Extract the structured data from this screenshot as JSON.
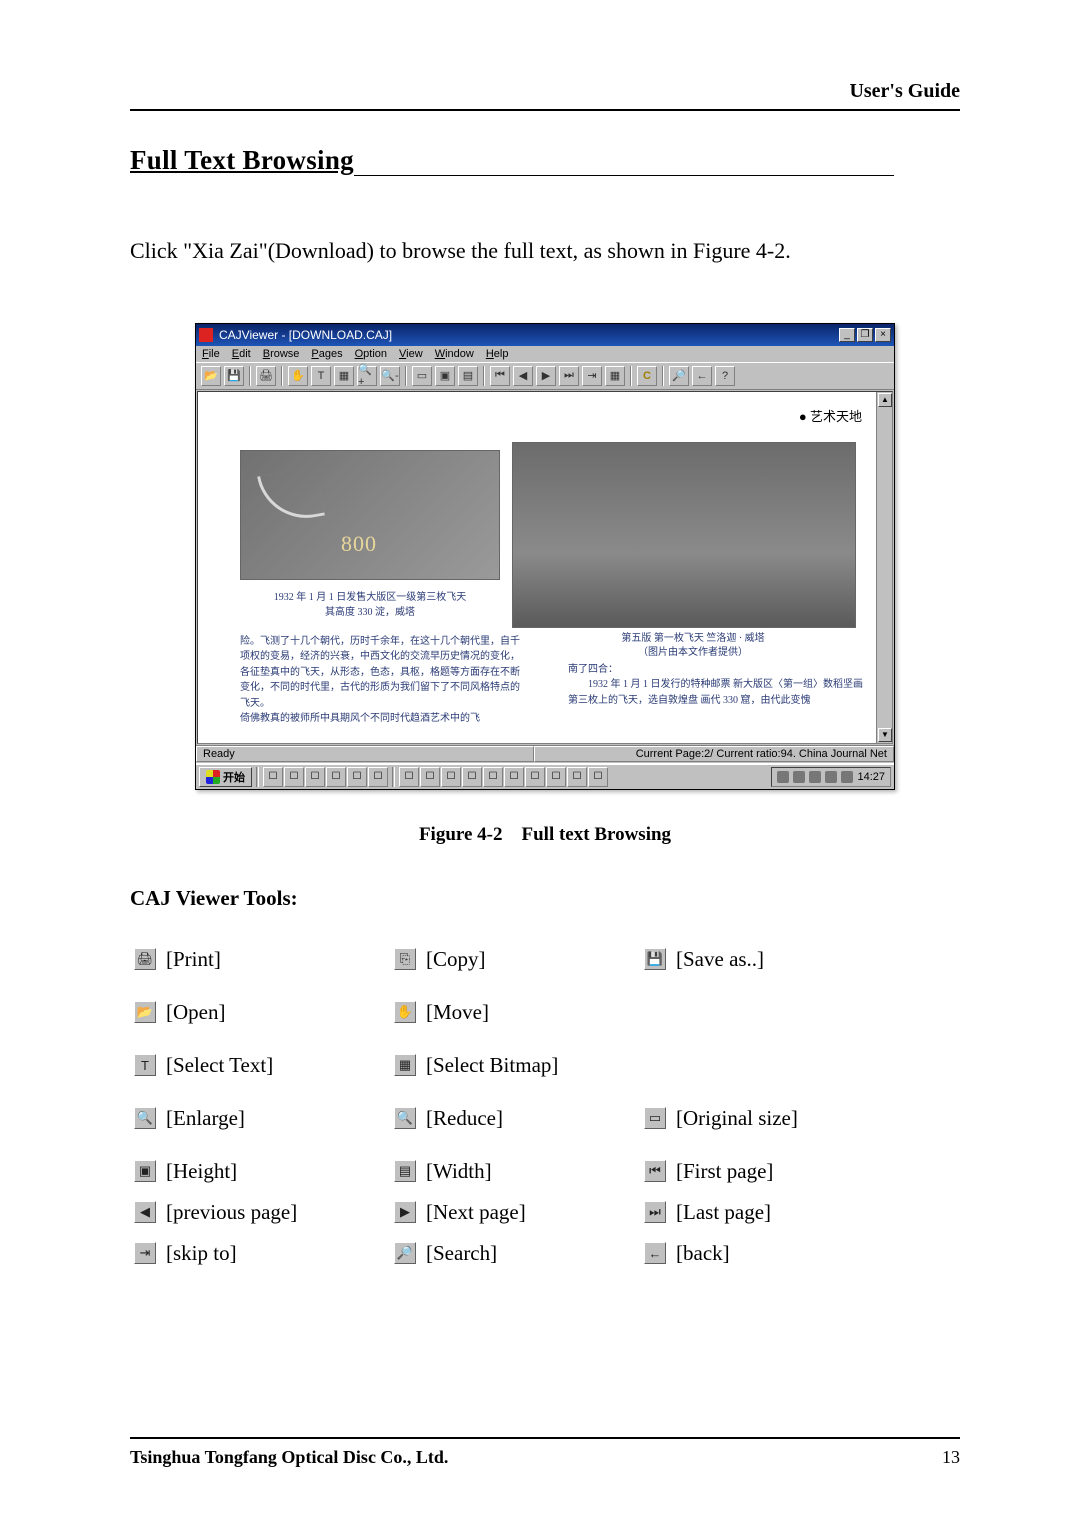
{
  "header": {
    "right": "User's Guide"
  },
  "section": {
    "title": "Full Text Browsing"
  },
  "body": {
    "p1": "Click \"Xia Zai\"(Download) to browse the full text, as shown in Figure 4-2."
  },
  "figure": {
    "title": "CAJViewer - [DOWNLOAD.CAJ]",
    "menus": {
      "file": "File",
      "edit": "Edit",
      "browse": "Browse",
      "pages": "Pages",
      "option": "Option",
      "view": "View",
      "window": "Window",
      "help": "Help"
    },
    "winbtns": {
      "min": "_",
      "max": "❐",
      "close": "×"
    },
    "toolbar_glyphs": [
      "📂",
      "💾",
      "",
      "🖨",
      "",
      "✋",
      "T",
      "▦",
      "🔍+",
      "🔍-",
      "",
      "▭",
      "▣",
      "▤",
      "",
      "⏮",
      "◀",
      "▶",
      "⏭",
      "⇥",
      "▦",
      "",
      "C",
      "",
      "🔎",
      "←",
      "?"
    ],
    "content": {
      "badge": "艺术天地",
      "logo": "800",
      "cap1_l1": "1932 年 1 月 1 日发售大版区一级第三枚飞天",
      "cap1_l2": "其高度 330 淀，威塔",
      "cap2_l1": "第五版 第一枚飞天 竺洛迦 · 威塔",
      "cap2_l2": "（图片由本文作者提供）",
      "para1": "险。飞测了十几个朝代，历时千余年，在这十几个朝代里，自千项权的变易，经济的兴衰，中西文化的交流早历史情况的变化，各征垫真中的飞天，从形态，色态，具枢，格题等方面存在不断变化，不同的时代里，古代的形质为我们留下了不同风格特点的飞天。",
      "para1b": "倚佛教真的被师所中具期风个不同时代趋酒艺术中的飞",
      "para2_h": "南了四合：",
      "para2": "1932 年 1 月 1 日发行的特种邮票 新大版区〈第一组〉数稻坚画第三枚上的飞天，选自敦煌盘 画代 330 窟，由代此变愧"
    },
    "status": {
      "left": "Ready",
      "right": "Current Page:2/ Current ratio:94. China Journal Net"
    },
    "taskbar": {
      "start": "开始",
      "clock": "14:27"
    },
    "caption_label": "Figure 4-2",
    "caption_text": "Full text Browsing"
  },
  "tools_heading": "CAJ Viewer Tools:",
  "tools": {
    "print": "[Print]",
    "copy": "[Copy]",
    "saveas": "[Save as..]",
    "open": "[Open]",
    "move": "[Move]",
    "seltext": "[Select Text]",
    "selbmp": "[Select Bitmap]",
    "enlarge": "[Enlarge]",
    "reduce": "[Reduce]",
    "orig": "[Original size]",
    "height": "[Height]",
    "width": "[Width]",
    "first": "[First page]",
    "prev": "[previous page]",
    "next": "[Next page]",
    "last": "[Last page]",
    "skip": "[skip to]",
    "search": "[Search]",
    "back": "[back]"
  },
  "footer": {
    "left": "Tsinghua Tongfang Optical Disc Co., Ltd.",
    "right": "13"
  }
}
